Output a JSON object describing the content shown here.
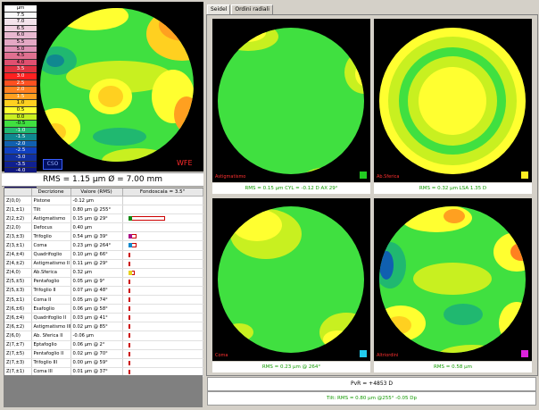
{
  "colors": {
    "map_bg": "#000000",
    "accent_green": "#119900",
    "accent_red": "#ff2a2a"
  },
  "scale": {
    "unit": "µm",
    "steps": [
      {
        "label": "7.5",
        "color": "#fafafa"
      },
      {
        "label": "7.0",
        "color": "#f4e4ec"
      },
      {
        "label": "6.5",
        "color": "#f0d0e0"
      },
      {
        "label": "6.0",
        "color": "#e8b8d0"
      },
      {
        "label": "5.5",
        "color": "#e4a8c4"
      },
      {
        "label": "5.0",
        "color": "#e090b4"
      },
      {
        "label": "4.5",
        "color": "#e07090"
      },
      {
        "label": "4.0",
        "color": "#e05070"
      },
      {
        "label": "3.5",
        "color": "#e03040"
      },
      {
        "label": "3.0",
        "color": "#ff2020"
      },
      {
        "label": "2.5",
        "color": "#ff5020"
      },
      {
        "label": "2.0",
        "color": "#ff8020"
      },
      {
        "label": "1.5",
        "color": "#ffa020"
      },
      {
        "label": "1.0",
        "color": "#ffd020"
      },
      {
        "label": "0.5",
        "color": "#ffff30"
      },
      {
        "label": "0.0",
        "color": "#c8f020"
      },
      {
        "label": "-0.5",
        "color": "#40e040"
      },
      {
        "label": "-1.0",
        "color": "#20b870"
      },
      {
        "label": "-1.5",
        "color": "#108890"
      },
      {
        "label": "-2.0",
        "color": "#1060b0"
      },
      {
        "label": "-2.5",
        "color": "#1040c0"
      },
      {
        "label": "-3.0",
        "color": "#1030a0"
      },
      {
        "label": "-3.5",
        "color": "#102090"
      },
      {
        "label": "-4.0",
        "color": "#101880"
      },
      {
        "label": "-4.5",
        "color": "#101070"
      },
      {
        "label": "-5.0",
        "color": "#100860"
      }
    ]
  },
  "main_map": {
    "logo": "CSO",
    "label": "WFE",
    "caption": "RMS = 1.15 µm    Ø = 7.00 mm"
  },
  "table": {
    "headers": {
      "code": "",
      "description": "Decrizione",
      "value": "Valore (RMS)",
      "scale": "Fondoscala = 3.5\""
    },
    "rows": [
      {
        "code": "Z(0,0)",
        "desc": "Pistone",
        "value": "-0.12 µm",
        "bar": 0
      },
      {
        "code": "Z(1,±1)",
        "desc": "Tilt",
        "value": "0.80 µm @ 255°",
        "bar": 0
      },
      {
        "code": "Z(2,±2)",
        "desc": "Astigmatismo",
        "value": "0.15 µm @ 29°",
        "bar": 0.98,
        "fill": "#118811"
      },
      {
        "code": "Z(2,0)",
        "desc": "Defocus",
        "value": "0.40 µm",
        "bar": 0
      },
      {
        "code": "Z(3,±3)",
        "desc": "Trifoglio",
        "value": "0.54 µm @ 39°",
        "bar": 0.22,
        "fill": "#aa1188"
      },
      {
        "code": "Z(3,±1)",
        "desc": "Coma",
        "value": "0.23 µm @ 264°",
        "bar": 0.22,
        "fill": "#1188cc"
      },
      {
        "code": "Z(4,±4)",
        "desc": "Quadrifoglio",
        "value": "0.10 µm @ 66°",
        "bar": 0.04
      },
      {
        "code": "Z(4,±2)",
        "desc": "Astigmatismo II",
        "value": "0.11 µm @ 29°",
        "bar": 0.04
      },
      {
        "code": "Z(4,0)",
        "desc": "Ab.Sferica",
        "value": "0.32 µm",
        "bar": 0.16,
        "fill": "#e8d020"
      },
      {
        "code": "Z(5,±5)",
        "desc": "Pentafoglio",
        "value": "0.05 µm @ 9°",
        "bar": 0.02
      },
      {
        "code": "Z(5,±3)",
        "desc": "Trifoglio II",
        "value": "0.07 µm @ 48°",
        "bar": 0.02
      },
      {
        "code": "Z(5,±1)",
        "desc": "Coma II",
        "value": "0.05 µm @ 74°",
        "bar": 0.02
      },
      {
        "code": "Z(6,±6)",
        "desc": "Esafoglio",
        "value": "0.06 µm @ 58°",
        "bar": 0.02
      },
      {
        "code": "Z(6,±4)",
        "desc": "Quadrifoglio II",
        "value": "0.03 µm @ 41°",
        "bar": 0.02
      },
      {
        "code": "Z(6,±2)",
        "desc": "Astigmatismo III",
        "value": "0.02 µm @ 85°",
        "bar": 0.02
      },
      {
        "code": "Z(6,0)",
        "desc": "Ab. Sferica II",
        "value": "-0.06 µm",
        "bar": 0.02
      },
      {
        "code": "Z(7,±7)",
        "desc": "Eptafoglio",
        "value": "0.06 µm @ 2°",
        "bar": 0.02
      },
      {
        "code": "Z(7,±5)",
        "desc": "Pentafoglio II",
        "value": "0.02 µm @ 70°",
        "bar": 0.02
      },
      {
        "code": "Z(7,±3)",
        "desc": "Trifoglio III",
        "value": "0.00 µm @ 59°",
        "bar": 0.02
      },
      {
        "code": "Z(7,±1)",
        "desc": "Coma III",
        "value": "0.01 µm @ 37°",
        "bar": 0.02
      }
    ]
  },
  "tabs": [
    {
      "label": "Seidel",
      "active": true
    },
    {
      "label": "Ordini radiali",
      "active": false
    }
  ],
  "seidel_maps": [
    {
      "title": "Astigmatismo",
      "caption": "RMS = 0.15 µm  CYL = -0.12 D AX 29°",
      "swatch": "#22cc22"
    },
    {
      "title": "Ab.Sferica",
      "caption": "RMS = 0.32 µm  LSA 1.35 D",
      "swatch": "#ffee22"
    },
    {
      "title": "Coma",
      "caption": "RMS = 0.23 µm @ 264°",
      "swatch": "#22ccee"
    },
    {
      "title": "Altriordini",
      "caption": "RMS = 0.58 µm",
      "swatch": "#dd22dd"
    }
  ],
  "footer": {
    "pvr": "PvR = +4853 D",
    "tilt": "Tilt: RMS = 0.80 µm @255°  -0.05 Dp"
  }
}
